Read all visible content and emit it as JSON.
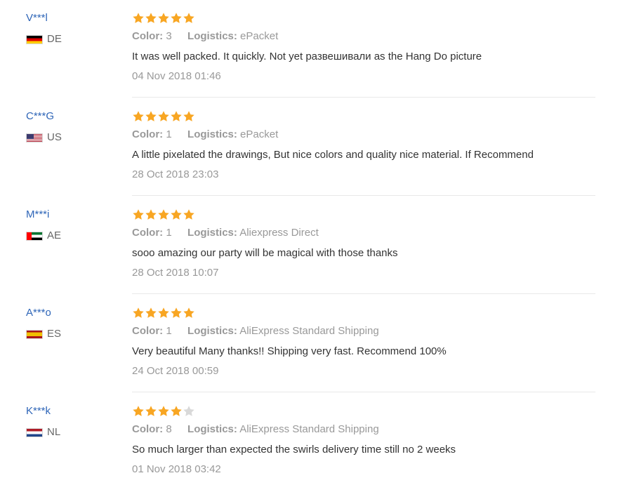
{
  "colors": {
    "user_name": "#2f66b8",
    "star_filled": "#f8a623",
    "star_empty": "#d9d9d9",
    "meta_text": "#999999",
    "body_text": "#333333"
  },
  "reviews": [
    {
      "user": "V***l",
      "flag_icon": "germany-flag-icon",
      "country": "DE",
      "rating": 5,
      "color_label": "Color:",
      "color_value": "3",
      "logistics_label": "Logistics:",
      "logistics_value": "ePacket",
      "text": "It was well packed. It quickly. Not yet развешивали as the Hang Do picture",
      "date": "04 Nov 2018 01:46"
    },
    {
      "user": "C***G",
      "flag_icon": "united-states-flag-icon",
      "country": "US",
      "rating": 5,
      "color_label": "Color:",
      "color_value": "1",
      "logistics_label": "Logistics:",
      "logistics_value": "ePacket",
      "text": "A little pixelated the drawings, But nice colors and quality nice material. If Recommend",
      "date": "28 Oct 2018 23:03"
    },
    {
      "user": "M***i",
      "flag_icon": "uae-flag-icon",
      "country": "AE",
      "rating": 5,
      "color_label": "Color:",
      "color_value": "1",
      "logistics_label": "Logistics:",
      "logistics_value": "Aliexpress Direct",
      "text": "sooo amazing our party will be magical with those thanks",
      "date": "28 Oct 2018 10:07"
    },
    {
      "user": "A***o",
      "flag_icon": "spain-flag-icon",
      "country": "ES",
      "rating": 5,
      "color_label": "Color:",
      "color_value": "1",
      "logistics_label": "Logistics:",
      "logistics_value": "AliExpress Standard Shipping",
      "text": "Very beautiful Many thanks!! Shipping very fast. Recommend 100%",
      "date": "24 Oct 2018 00:59"
    },
    {
      "user": "K***k",
      "flag_icon": "netherlands-flag-icon",
      "country": "NL",
      "rating": 4,
      "color_label": "Color:",
      "color_value": "8",
      "logistics_label": "Logistics:",
      "logistics_value": "AliExpress Standard Shipping",
      "text": "So much larger than expected the swirls delivery time still no 2 weeks",
      "date": "01 Nov 2018 03:42"
    }
  ]
}
